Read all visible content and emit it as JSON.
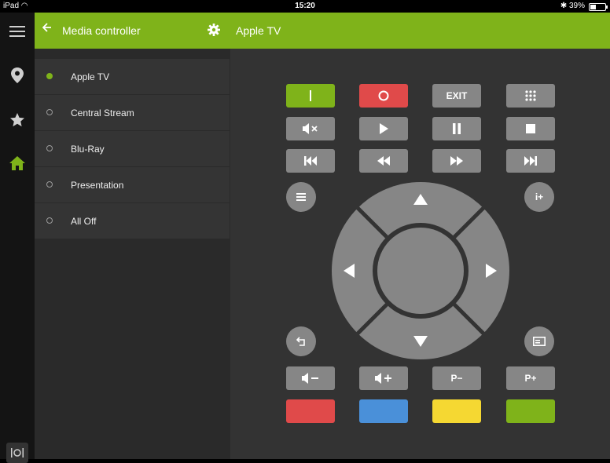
{
  "status": {
    "device": "iPad",
    "time": "15:20",
    "battery": "39%",
    "battery_level": 0.39
  },
  "rail": {
    "items": [
      {
        "icon": "menu-icon"
      },
      {
        "icon": "location-pin-icon"
      },
      {
        "icon": "star-icon"
      },
      {
        "icon": "home-icon",
        "active": true
      }
    ],
    "bottom_icon": "dining-icon"
  },
  "sidebar": {
    "title": "Media controller",
    "back_icon": "arrow-left-icon",
    "settings_icon": "gear-icon",
    "items": [
      {
        "label": "Apple TV",
        "selected": true
      },
      {
        "label": "Central Stream",
        "selected": false
      },
      {
        "label": "Blu-Ray",
        "selected": false
      },
      {
        "label": "Presentation",
        "selected": false
      },
      {
        "label": "All Off",
        "selected": false
      }
    ]
  },
  "main": {
    "title": "Apple TV",
    "remote": {
      "exit_label": "EXIT",
      "info_label": "i+",
      "vol_down_label": "◀−",
      "vol_up_label": "◀+",
      "prog_down_label": "P−",
      "prog_up_label": "P+"
    }
  },
  "colors": {
    "accent": "#7fb31a",
    "power_off": "#e04a4a",
    "red": "#e04a4a",
    "blue": "#4a90d9",
    "yellow": "#f5d832",
    "green": "#7fb31a",
    "button": "#868686"
  }
}
